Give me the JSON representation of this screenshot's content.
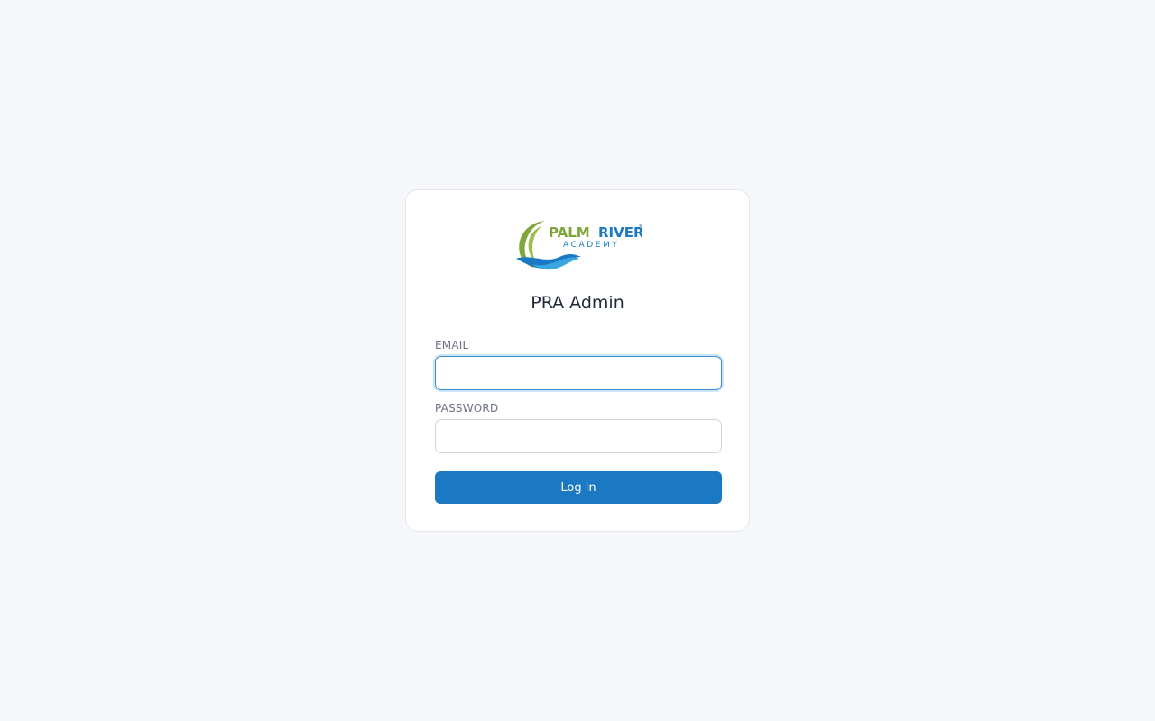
{
  "logo": {
    "word_1": "PALM",
    "word_2": "RIVER",
    "subtitle": "ACADEMY",
    "registered": "®",
    "colors": {
      "green": "#7fa63a",
      "blue": "#1b78c3",
      "light_blue": "#3aa6df"
    }
  },
  "page": {
    "title": "PRA Admin"
  },
  "form": {
    "email_label": "EMAIL",
    "email_value": "",
    "password_label": "PASSWORD",
    "password_value": "",
    "submit_label": "Log in"
  },
  "colors": {
    "background": "#f5f7fa",
    "card": "#ffffff",
    "accent": "#1b78c3",
    "focus_border": "#3b8fd8"
  }
}
